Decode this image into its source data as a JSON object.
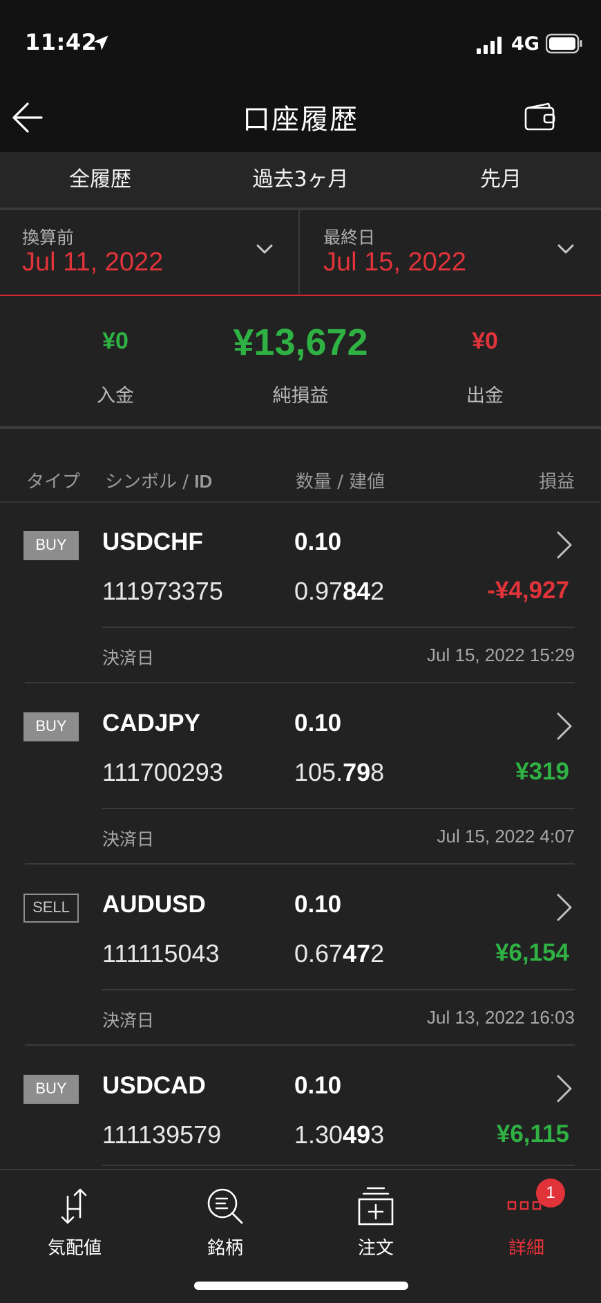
{
  "status_bar": {
    "time": "11:42",
    "network": "4G"
  },
  "nav": {
    "title": "口座履歴"
  },
  "filters": [
    "全履歴",
    "過去3ヶ月",
    "先月"
  ],
  "date_range": {
    "start_label": "換算前",
    "start_value": "Jul 11, 2022",
    "end_label": "最終日",
    "end_value": "Jul 15, 2022"
  },
  "summary": {
    "deposit_value": "¥0",
    "deposit_label": "入金",
    "net_value": "¥13,672",
    "net_label": "純損益",
    "withdraw_value": "¥0",
    "withdraw_label": "出金"
  },
  "list_header": {
    "type": "タイプ",
    "symbol": "シンボル / ",
    "symbol_id": "ID",
    "qty": "数量 / 建値",
    "pl": "損益"
  },
  "trades": [
    {
      "type": "BUY",
      "symbol": "USDCHF",
      "qty": "0.10",
      "id": "111973375",
      "price_pre": "0.97",
      "price_bold": "84",
      "price_post": "2",
      "pl": "-¥4,927",
      "pl_color": "#e0333a",
      "settle_label": "決済日",
      "settle_date": "Jul 15, 2022 15:29"
    },
    {
      "type": "BUY",
      "symbol": "CADJPY",
      "qty": "0.10",
      "id": "111700293",
      "price_pre": "105.",
      "price_bold": "79",
      "price_post": "8",
      "pl": "¥319",
      "pl_color": "#2fb144",
      "settle_label": "決済日",
      "settle_date": "Jul 15, 2022 4:07"
    },
    {
      "type": "SELL",
      "symbol": "AUDUSD",
      "qty": "0.10",
      "id": "111115043",
      "price_pre": "0.67",
      "price_bold": "47",
      "price_post": "2",
      "pl": "¥6,154",
      "pl_color": "#2fb144",
      "settle_label": "決済日",
      "settle_date": "Jul 13, 2022 16:03"
    },
    {
      "type": "BUY",
      "symbol": "USDCAD",
      "qty": "0.10",
      "id": "111139579",
      "price_pre": "1.30",
      "price_bold": "49",
      "price_post": "3",
      "pl": "¥6,115",
      "pl_color": "#2fb144",
      "settle_label": "",
      "settle_date": ""
    }
  ],
  "tab_bar": {
    "items": [
      {
        "label": "気配値",
        "icon": "arrows-updown-icon"
      },
      {
        "label": "銘柄",
        "icon": "search-list-icon"
      },
      {
        "label": "注文",
        "icon": "order-plus-icon"
      },
      {
        "label": "詳細",
        "icon": "details-icon"
      }
    ],
    "active_index": 3,
    "badge_count": "1"
  },
  "colors": {
    "accent_red": "#e0333a",
    "profit_green": "#2fb144",
    "background": "#222222"
  }
}
